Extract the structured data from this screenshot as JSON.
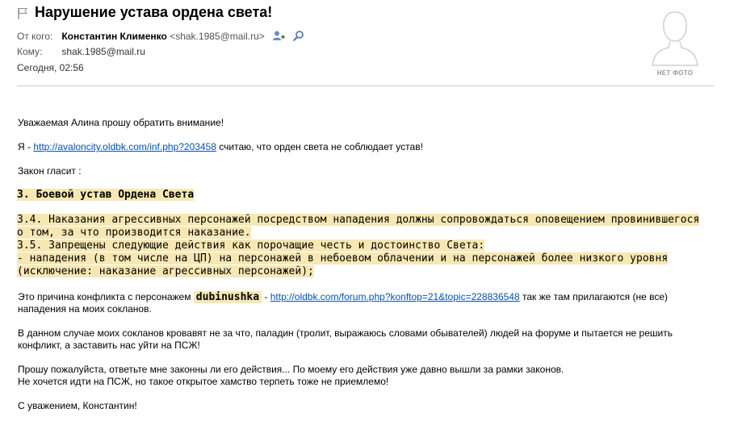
{
  "message": {
    "subject": "Нарушение устава ордена света!",
    "from_label": "От кого:",
    "from_name": "Константин Клименко",
    "from_email": "<shak.1985@mail.ru>",
    "to_label": "Кому:",
    "to_value": "shak.1985@mail.ru",
    "date": "Сегодня, 02:56",
    "avatar_caption": "НЕТ ФОТО"
  },
  "icons": {
    "flag": "flag-icon",
    "add_contact": "add-contact-icon",
    "search": "search-icon",
    "avatar": "no-photo-avatar"
  },
  "body": {
    "greeting": "Уважаемая Алина прошу обратить внимание!",
    "p1_before": "Я - ",
    "p1_link": "http://avaloncity.oldbk.com/inf.php?203458",
    "p1_after": "  считаю, что орден света не соблюдает устав!",
    "law_intro": "Закон гласит :",
    "rule_title": "3. Боевой устав Ордена Света",
    "rule_lines": [
      "3.4. Наказания агрессивных персонажей посредством нападения должны сопровождаться оповещением провинившегося",
      "о том, за что производится наказание.",
      "3.5. Запрещены следующие действия как порочащие честь и достоинство Света:",
      "- нападения (в том числе на ЦП) на персонажей в небоевом облачении и на персонажей более низкого уровня",
      "(исключение: наказание агрессивных персонажей);"
    ],
    "conflict_before": "Это причина конфликта с персонажем ",
    "conflict_nick": "dubinushka",
    "conflict_mid": "  - ",
    "conflict_link": "http://oldbk.com/forum.php?konftop=21&topic=228836548",
    "conflict_after": " так же там прилагаются (не все)",
    "conflict_line2": "нападения на моих сокланов.",
    "p_case_1": "В данном случае моих сокланов кровавят не за что, паладин (тролит, выражаюсь  словами обывателей) людей на форуме и пытается не решить",
    "p_case_2": "конфликт, а заставить нас уйти на ПСЖ!",
    "p_ask_1": "Прошу пожалуйста, ответьте мне законны ли его действия... По моему его действия уже давно вышли за рамки законов.",
    "p_ask_2": "Не хочется идти на ПСЖ, но такое открытое хамство терпеть тоже не приемлемо!",
    "signature": "С уважением, Константин!"
  }
}
